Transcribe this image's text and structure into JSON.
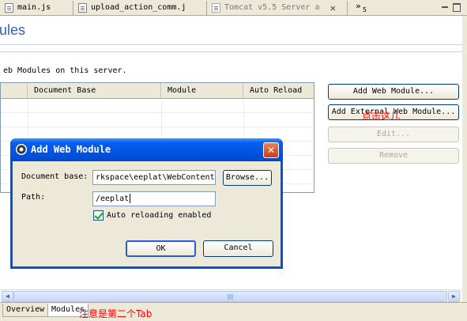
{
  "editor_tabs": [
    {
      "label": "main.js"
    },
    {
      "label": "upload_action_comm.j"
    },
    {
      "label": "Tomcat v5.5 Server a",
      "active": true
    }
  ],
  "overflow_count": "5",
  "form_title": "ules",
  "section_description": "eb Modules on this server.",
  "table": {
    "columns": [
      "",
      "Document Base",
      "Module",
      "Auto Reload"
    ]
  },
  "buttons": {
    "add_web_module": "Add Web Module...",
    "add_external": "Add External Web Module...",
    "edit": "Edit...",
    "remove": "Remove"
  },
  "annotations": {
    "click_here": "点击这儿",
    "note_tab": "注意是第二个Tab"
  },
  "dialog": {
    "title": "Add Web Module",
    "close_glyph": "✕",
    "document_base_label": "Document base:",
    "document_base_value": "rkspace\\eeplat\\WebContent",
    "browse_label": "Browse...",
    "path_label": "Path:",
    "path_value": "/eeplat",
    "auto_reload_label": "Auto reloading enabled",
    "auto_reload_checked": true,
    "ok_label": "OK",
    "cancel_label": "Cancel"
  },
  "page_tabs": [
    {
      "label": "Overview"
    },
    {
      "label": "Modules",
      "active": true
    }
  ],
  "colors": {
    "title_blue": "#3263b1",
    "annotation_red": "#ff0000",
    "dialog_titlebar": "#0054e3"
  }
}
